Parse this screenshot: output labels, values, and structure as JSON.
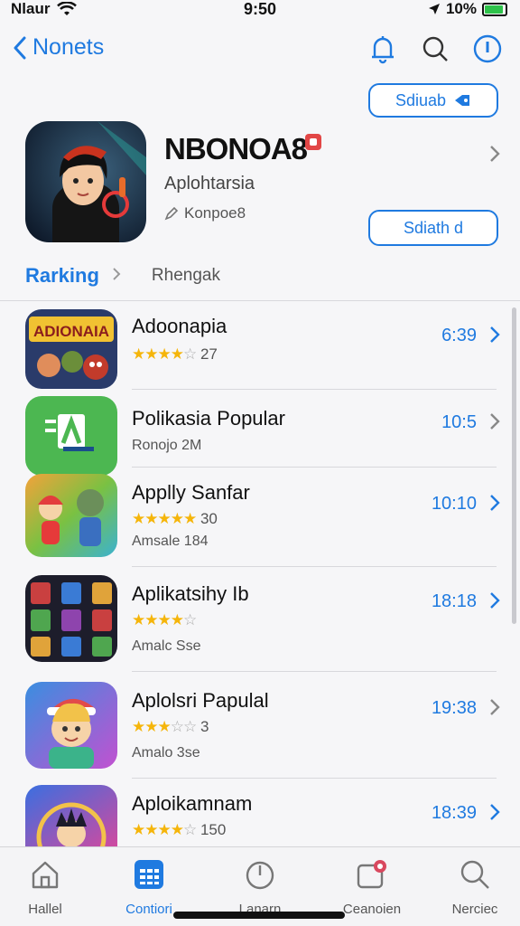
{
  "status_bar": {
    "carrier": "Nlaur",
    "time": "9:50",
    "battery": "10%",
    "battery_level": 0.9,
    "battery_color": "#2ec24a"
  },
  "nav": {
    "back_label": "Nonets"
  },
  "buttons": {
    "top_action": "Sdiuab",
    "featured_action": "Sdiath d"
  },
  "featured": {
    "title": "NBONOA8",
    "subtitle": "Aplohtarsia",
    "meta": "Konpoe8"
  },
  "tabs": {
    "active": "Rarking",
    "inactive": "Rhengak"
  },
  "apps": [
    {
      "name": "Adoonapia",
      "stars_full": "★★★★",
      "stars_empty": "☆",
      "rating_text": "27",
      "sub": "",
      "value": "6:39",
      "icon_text": "ADIONAIA"
    },
    {
      "name": "Polikasia Popular",
      "stars_full": "",
      "stars_empty": "",
      "rating_text": "",
      "sub": "Ronojo 2M",
      "value": "10:5",
      "icon_text": "≡A"
    },
    {
      "name": "Applly Sanfar",
      "stars_full": "★★★★★",
      "stars_empty": "",
      "rating_text": "30",
      "sub": "Amsale 184",
      "value": "10:10",
      "icon_text": ""
    },
    {
      "name": "Aplikatsihy Ib",
      "stars_full": "★★★★",
      "stars_empty": "☆",
      "rating_text": "",
      "sub": "Amalc Sse",
      "value": "18:18",
      "icon_text": ""
    },
    {
      "name": "Aplolsri Papulal",
      "stars_full": "★★★",
      "stars_empty": "☆☆",
      "rating_text": "3",
      "sub": "Amalo 3se",
      "value": "19:38",
      "icon_text": ""
    },
    {
      "name": "Aploikamnam",
      "stars_full": "★★★★",
      "stars_empty": "☆",
      "rating_text": "150",
      "sub": "",
      "value": "18:39",
      "icon_text": ""
    }
  ],
  "tab_bar": [
    {
      "label": "Hallel",
      "icon": "home-icon"
    },
    {
      "label": "Contiori",
      "icon": "grid-icon"
    },
    {
      "label": "Lanarn",
      "icon": "timer-icon"
    },
    {
      "label": "Ceanoien",
      "icon": "notification-icon"
    },
    {
      "label": "Nerciec",
      "icon": "search-icon"
    }
  ]
}
